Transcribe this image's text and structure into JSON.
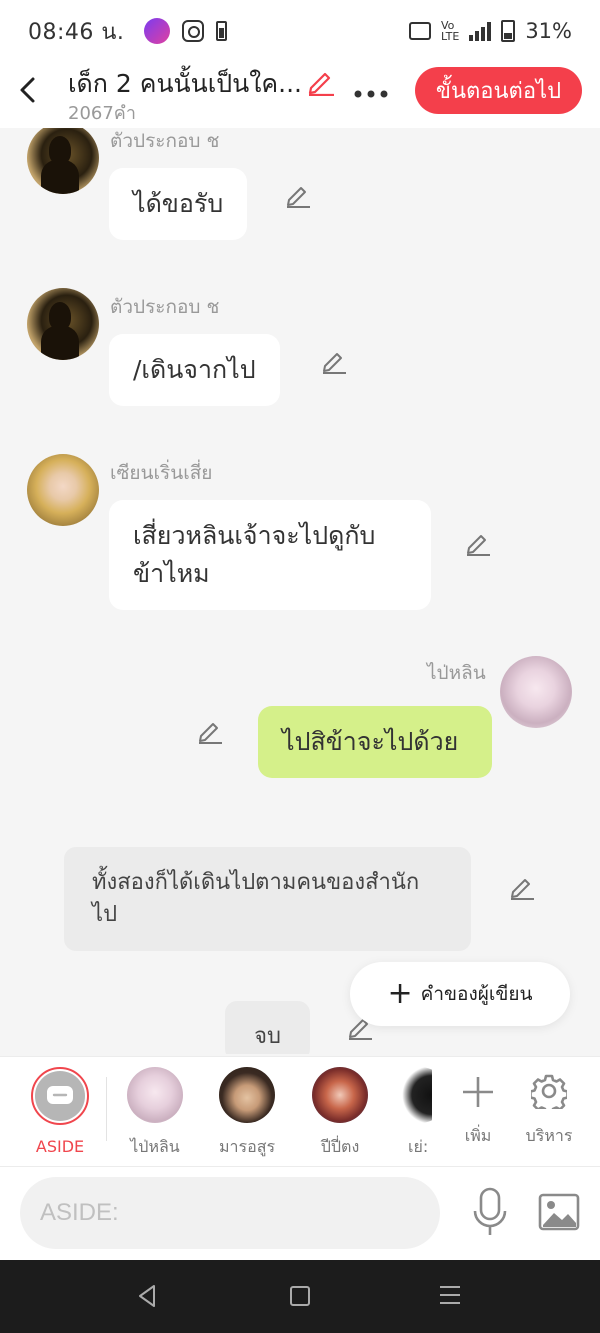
{
  "status_bar": {
    "time": "08:46 น.",
    "battery": "31%"
  },
  "header": {
    "title": "เด็ก 2 คนนั้นเป็นใค...",
    "word_count": "2067คำ",
    "next_button": "ขั้นตอนต่อไป"
  },
  "messages": [
    {
      "speaker": "ตัวประกอบ ช",
      "text": "ได้ขอรับ",
      "side": "left",
      "avatar": "silhouette"
    },
    {
      "speaker": "ตัวประกอบ ช",
      "text": "/เดินจากไป",
      "side": "left",
      "avatar": "silhouette"
    },
    {
      "speaker": "เซียนเริ่นเสี่ย",
      "text": "เสี่ยวหลินเจ้าจะไปดูกับ\nข้าไหม",
      "side": "left",
      "avatar": "blonde"
    },
    {
      "speaker": "ไป่หลิน",
      "text": "ไปสิข้าจะไปด้วย",
      "side": "right",
      "avatar": "angel"
    }
  ],
  "narration": "ทั้งสองก็ได้เดินไปตามคนของสำนัก\nไป",
  "ending": "จบ",
  "author_button": "คำของผู้เขียน",
  "characters": [
    {
      "name": "ASIDE",
      "active": true
    },
    {
      "name": "ไป่หลิน"
    },
    {
      "name": "มารอสูร"
    },
    {
      "name": "ปีปี่ตง"
    },
    {
      "name": "เย่:"
    }
  ],
  "tools": {
    "add": "เพิ่ม",
    "manage": "บริหาร"
  },
  "input": {
    "placeholder": "ASIDE:"
  },
  "colors": {
    "accent": "#f43f4b",
    "my_bubble": "#d5f08a",
    "background": "#f5f5f5"
  }
}
